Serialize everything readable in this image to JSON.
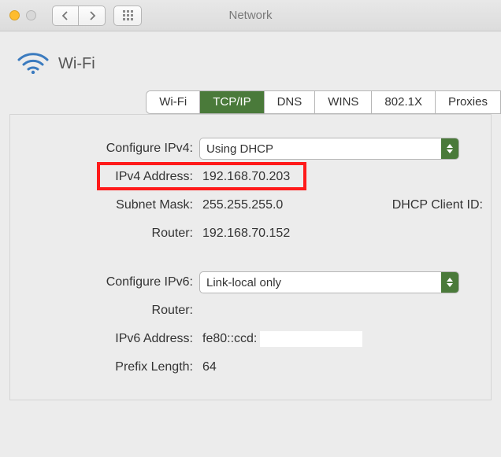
{
  "window": {
    "title": "Network"
  },
  "header": {
    "interface_name": "Wi-Fi"
  },
  "tabs": {
    "wifi": "Wi-Fi",
    "tcpip": "TCP/IP",
    "dns": "DNS",
    "wins": "WINS",
    "8021x": "802.1X",
    "proxies": "Proxies"
  },
  "ipv4": {
    "configure_label": "Configure IPv4:",
    "configure_value": "Using DHCP",
    "address_label": "IPv4 Address:",
    "address_value": "192.168.70.203",
    "subnet_label": "Subnet Mask:",
    "subnet_value": "255.255.255.0",
    "router_label": "Router:",
    "router_value": "192.168.70.152",
    "dhcp_client_label": "DHCP Client ID:"
  },
  "ipv6": {
    "configure_label": "Configure IPv6:",
    "configure_value": "Link-local only",
    "router_label": "Router:",
    "router_value": "",
    "address_label": "IPv6 Address:",
    "address_value": "fe80::ccd:",
    "prefix_label": "Prefix Length:",
    "prefix_value": "64"
  }
}
